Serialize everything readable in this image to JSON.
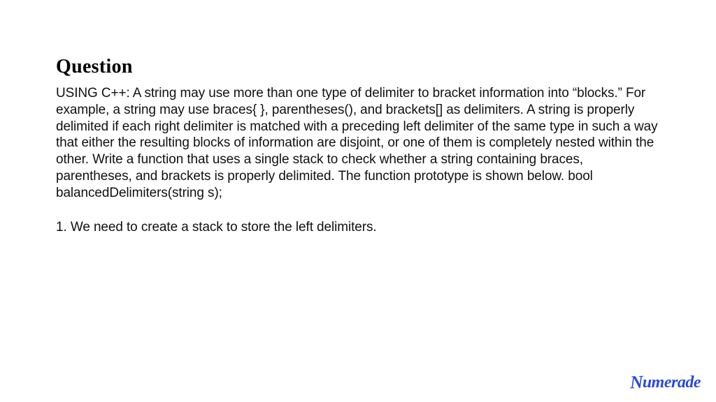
{
  "heading": "Question",
  "body": "USING C++: A string may use more than one type of delimiter to bracket information into “blocks.” For example, a string may use braces{ }, parentheses(), and brackets[] as delimiters. A string is properly delimited if each right delimiter is matched with a preceding left delimiter of the same type in such a way that either the resulting blocks of information are disjoint, or one of them is completely nested within the other. Write a function that uses a single stack to check whether a string containing braces, parentheses, and brackets is properly delimited. The function prototype is shown below. bool balancedDelimiters(string s);",
  "step": "1. We need to create a stack to store the left delimiters.",
  "brand": "Numerade"
}
